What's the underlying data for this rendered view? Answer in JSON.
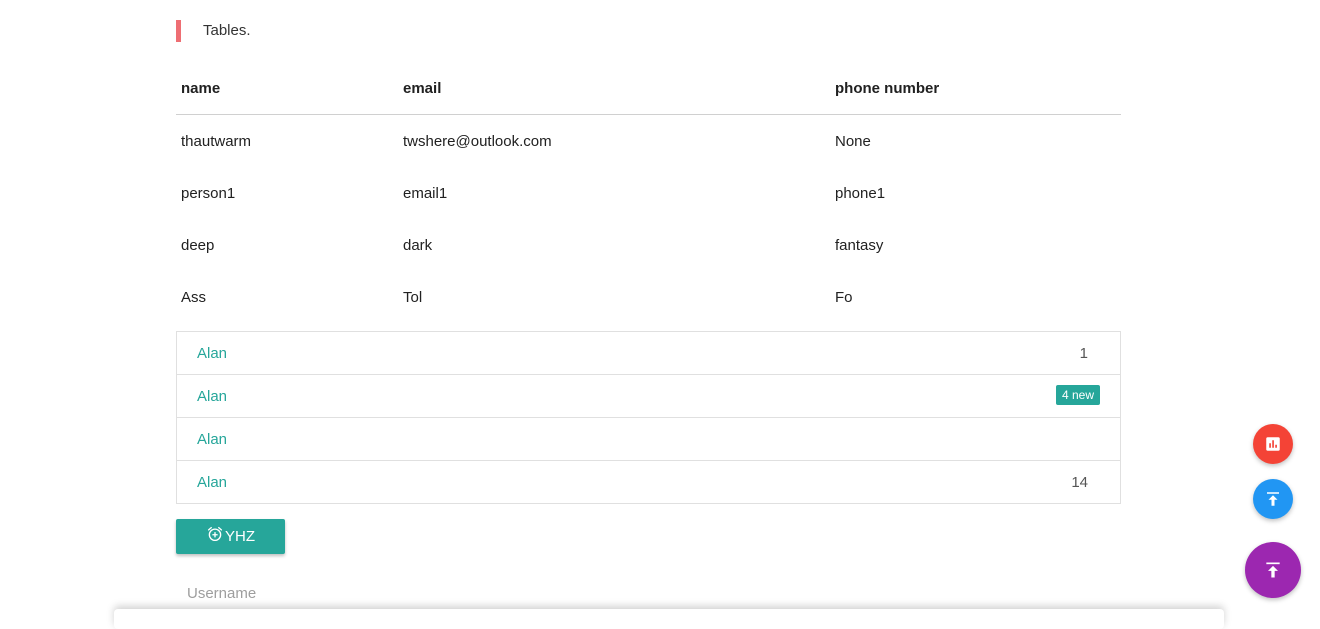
{
  "blockquote": {
    "text": "Tables."
  },
  "table": {
    "headers": [
      "name",
      "email",
      "phone number"
    ],
    "rows": [
      [
        "thautwarm",
        "twshere@outlook.com",
        "None"
      ],
      [
        "person1",
        "email1",
        "phone1"
      ],
      [
        "deep",
        "dark",
        "fantasy"
      ],
      [
        "Ass",
        "Tol",
        "Fo"
      ]
    ]
  },
  "collection": [
    {
      "label": "Alan",
      "count": "1"
    },
    {
      "label": "Alan",
      "badge": "4 new"
    },
    {
      "label": "Alan"
    },
    {
      "label": "Alan",
      "count": "14"
    }
  ],
  "button": {
    "label": "YHZ",
    "icon": "alarm-add-icon"
  },
  "username": {
    "placeholder": "Username",
    "value": ""
  },
  "fabs": [
    {
      "icon": "insert-chart-icon",
      "color": "#f44336"
    },
    {
      "icon": "vertical-align-top-icon",
      "color": "#2196f3"
    },
    {
      "icon": "vertical-align-top-icon",
      "color": "#9c27b0"
    }
  ],
  "colors": {
    "accent": "#26a69a",
    "quote_border": "#ee6e73"
  }
}
